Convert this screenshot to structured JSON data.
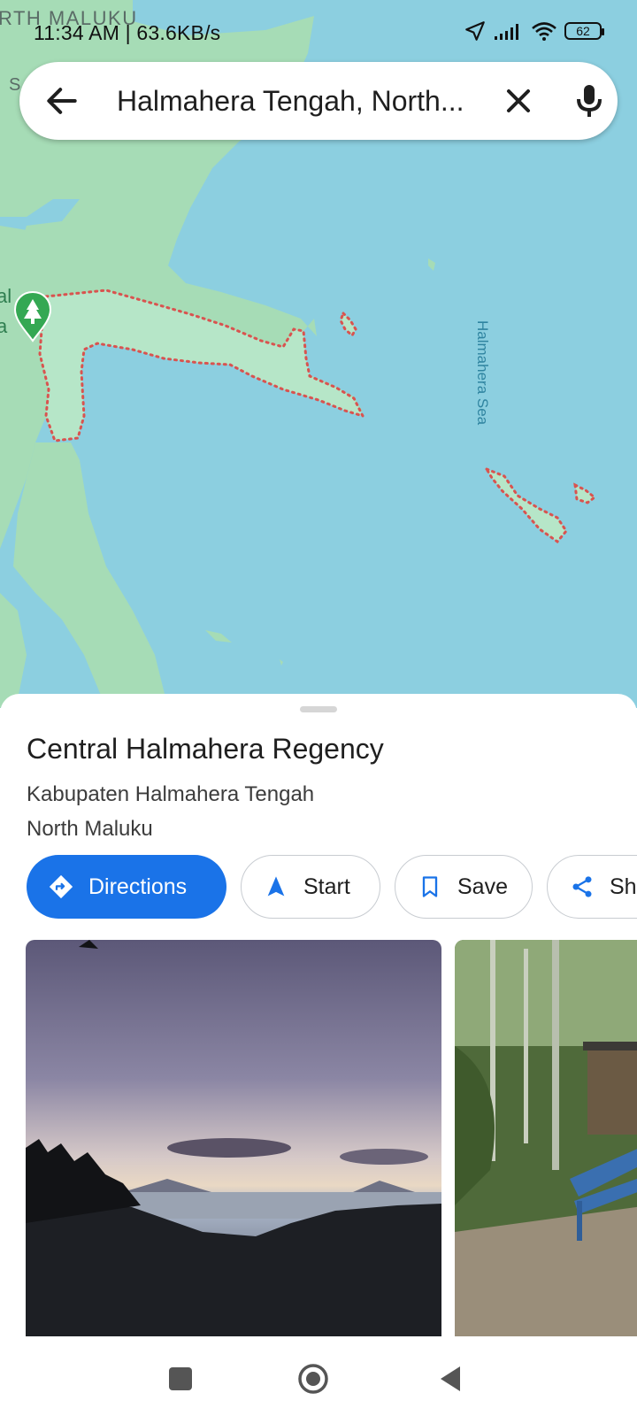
{
  "status_bar": {
    "time_speed": "11:34 AM | 63.6KB/s",
    "battery": "62"
  },
  "search": {
    "query": "Halmahera Tengah, North..."
  },
  "map": {
    "colors": {
      "water": "#8ccfe0",
      "land": "#a6dcb6",
      "boundary": "#d9534f",
      "pin": "#34a853"
    },
    "labels": {
      "region_top": "RTH MALUKU",
      "edge_s": "S",
      "edge_al": "al",
      "edge_a": "a",
      "sea": "Halmahera Sea"
    },
    "pin_icon": "tree-icon"
  },
  "place": {
    "title": "Central Halmahera Regency",
    "subtitle_1": "Kabupaten Halmahera Tengah",
    "subtitle_2": "North Maluku"
  },
  "actions": {
    "directions": "Directions",
    "start": "Start",
    "save": "Save",
    "share": "Sh"
  },
  "colors": {
    "accent": "#1a73e8"
  }
}
